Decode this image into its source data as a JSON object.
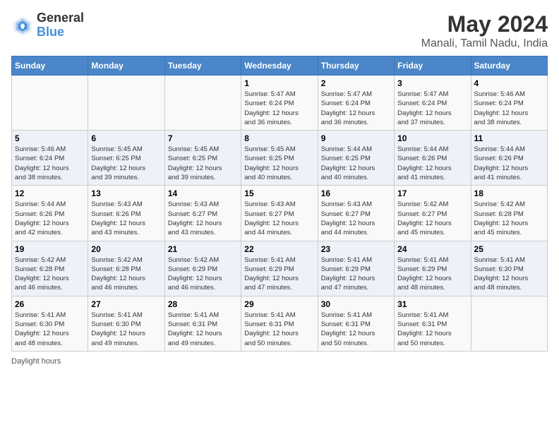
{
  "logo": {
    "line1": "General",
    "line2": "Blue"
  },
  "title": "May 2024",
  "subtitle": "Manali, Tamil Nadu, India",
  "days_of_week": [
    "Sunday",
    "Monday",
    "Tuesday",
    "Wednesday",
    "Thursday",
    "Friday",
    "Saturday"
  ],
  "footer": "Daylight hours",
  "weeks": [
    [
      {
        "day": "",
        "info": ""
      },
      {
        "day": "",
        "info": ""
      },
      {
        "day": "",
        "info": ""
      },
      {
        "day": "1",
        "info": "Sunrise: 5:47 AM\nSunset: 6:24 PM\nDaylight: 12 hours\nand 36 minutes."
      },
      {
        "day": "2",
        "info": "Sunrise: 5:47 AM\nSunset: 6:24 PM\nDaylight: 12 hours\nand 36 minutes."
      },
      {
        "day": "3",
        "info": "Sunrise: 5:47 AM\nSunset: 6:24 PM\nDaylight: 12 hours\nand 37 minutes."
      },
      {
        "day": "4",
        "info": "Sunrise: 5:46 AM\nSunset: 6:24 PM\nDaylight: 12 hours\nand 38 minutes."
      }
    ],
    [
      {
        "day": "5",
        "info": "Sunrise: 5:46 AM\nSunset: 6:24 PM\nDaylight: 12 hours\nand 38 minutes."
      },
      {
        "day": "6",
        "info": "Sunrise: 5:45 AM\nSunset: 6:25 PM\nDaylight: 12 hours\nand 39 minutes."
      },
      {
        "day": "7",
        "info": "Sunrise: 5:45 AM\nSunset: 6:25 PM\nDaylight: 12 hours\nand 39 minutes."
      },
      {
        "day": "8",
        "info": "Sunrise: 5:45 AM\nSunset: 6:25 PM\nDaylight: 12 hours\nand 40 minutes."
      },
      {
        "day": "9",
        "info": "Sunrise: 5:44 AM\nSunset: 6:25 PM\nDaylight: 12 hours\nand 40 minutes."
      },
      {
        "day": "10",
        "info": "Sunrise: 5:44 AM\nSunset: 6:26 PM\nDaylight: 12 hours\nand 41 minutes."
      },
      {
        "day": "11",
        "info": "Sunrise: 5:44 AM\nSunset: 6:26 PM\nDaylight: 12 hours\nand 41 minutes."
      }
    ],
    [
      {
        "day": "12",
        "info": "Sunrise: 5:44 AM\nSunset: 6:26 PM\nDaylight: 12 hours\nand 42 minutes."
      },
      {
        "day": "13",
        "info": "Sunrise: 5:43 AM\nSunset: 6:26 PM\nDaylight: 12 hours\nand 43 minutes."
      },
      {
        "day": "14",
        "info": "Sunrise: 5:43 AM\nSunset: 6:27 PM\nDaylight: 12 hours\nand 43 minutes."
      },
      {
        "day": "15",
        "info": "Sunrise: 5:43 AM\nSunset: 6:27 PM\nDaylight: 12 hours\nand 44 minutes."
      },
      {
        "day": "16",
        "info": "Sunrise: 5:43 AM\nSunset: 6:27 PM\nDaylight: 12 hours\nand 44 minutes."
      },
      {
        "day": "17",
        "info": "Sunrise: 5:42 AM\nSunset: 6:27 PM\nDaylight: 12 hours\nand 45 minutes."
      },
      {
        "day": "18",
        "info": "Sunrise: 5:42 AM\nSunset: 6:28 PM\nDaylight: 12 hours\nand 45 minutes."
      }
    ],
    [
      {
        "day": "19",
        "info": "Sunrise: 5:42 AM\nSunset: 6:28 PM\nDaylight: 12 hours\nand 46 minutes."
      },
      {
        "day": "20",
        "info": "Sunrise: 5:42 AM\nSunset: 6:28 PM\nDaylight: 12 hours\nand 46 minutes."
      },
      {
        "day": "21",
        "info": "Sunrise: 5:42 AM\nSunset: 6:29 PM\nDaylight: 12 hours\nand 46 minutes."
      },
      {
        "day": "22",
        "info": "Sunrise: 5:41 AM\nSunset: 6:29 PM\nDaylight: 12 hours\nand 47 minutes."
      },
      {
        "day": "23",
        "info": "Sunrise: 5:41 AM\nSunset: 6:29 PM\nDaylight: 12 hours\nand 47 minutes."
      },
      {
        "day": "24",
        "info": "Sunrise: 5:41 AM\nSunset: 6:29 PM\nDaylight: 12 hours\nand 48 minutes."
      },
      {
        "day": "25",
        "info": "Sunrise: 5:41 AM\nSunset: 6:30 PM\nDaylight: 12 hours\nand 48 minutes."
      }
    ],
    [
      {
        "day": "26",
        "info": "Sunrise: 5:41 AM\nSunset: 6:30 PM\nDaylight: 12 hours\nand 48 minutes."
      },
      {
        "day": "27",
        "info": "Sunrise: 5:41 AM\nSunset: 6:30 PM\nDaylight: 12 hours\nand 49 minutes."
      },
      {
        "day": "28",
        "info": "Sunrise: 5:41 AM\nSunset: 6:31 PM\nDaylight: 12 hours\nand 49 minutes."
      },
      {
        "day": "29",
        "info": "Sunrise: 5:41 AM\nSunset: 6:31 PM\nDaylight: 12 hours\nand 50 minutes."
      },
      {
        "day": "30",
        "info": "Sunrise: 5:41 AM\nSunset: 6:31 PM\nDaylight: 12 hours\nand 50 minutes."
      },
      {
        "day": "31",
        "info": "Sunrise: 5:41 AM\nSunset: 6:31 PM\nDaylight: 12 hours\nand 50 minutes."
      },
      {
        "day": "",
        "info": ""
      }
    ]
  ]
}
